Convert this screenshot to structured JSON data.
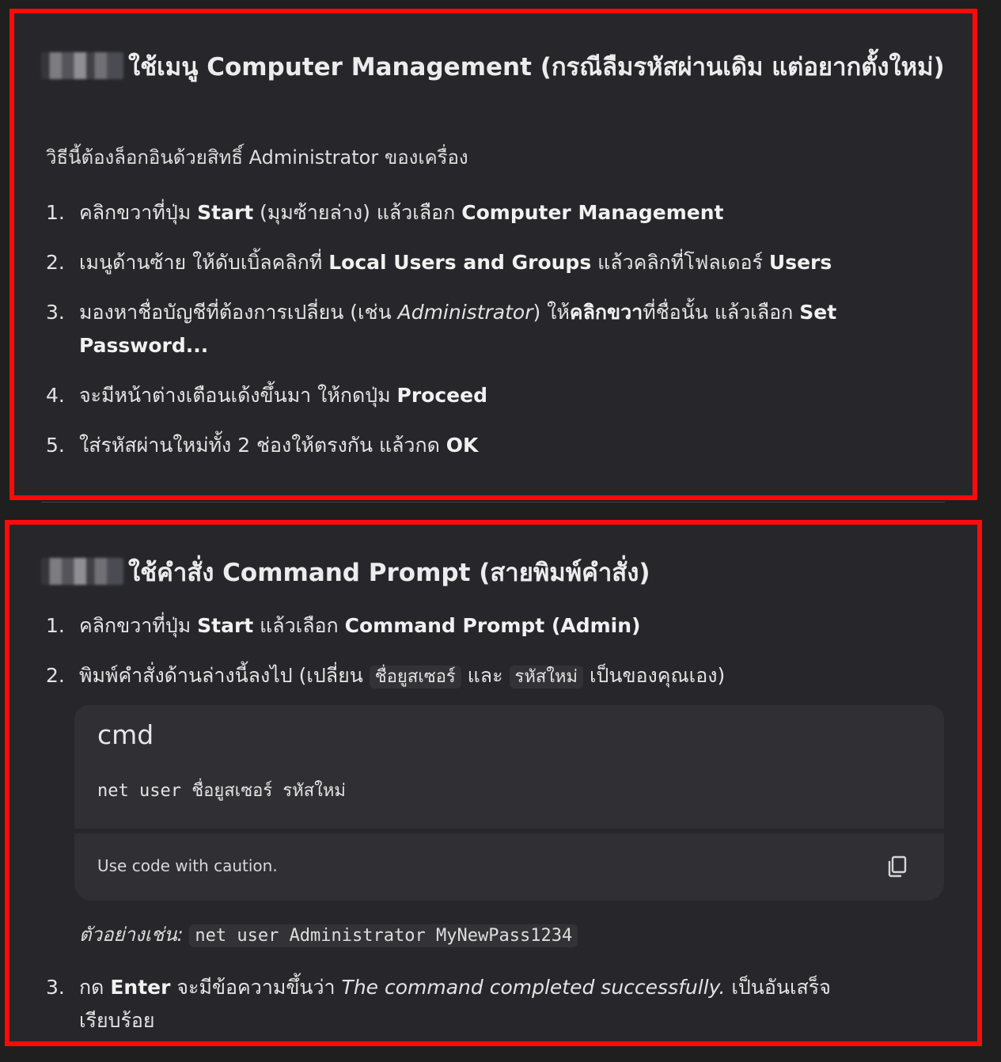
{
  "section1": {
    "heading": "ใช้เมนู Computer Management (กรณีลืมรหัสผ่านเดิม แต่อยากตั้งใหม่)",
    "intro": "วิธีนี้ต้องล็อกอินด้วยสิทธิ์ Administrator ของเครื่อง",
    "steps": [
      {
        "num": "1.",
        "t1": "คลิกขวาที่ปุ่ม ",
        "b1": "Start",
        "t2": " (มุมซ้ายล่าง) แล้วเลือก ",
        "b2": "Computer Management"
      },
      {
        "num": "2.",
        "t1": "เมนูด้านซ้าย ให้ดับเบิ้ลคลิกที่ ",
        "b1": "Local Users and Groups",
        "t2": " แล้วคลิกที่โฟลเดอร์ ",
        "b2": "Users"
      },
      {
        "num": "3.",
        "t1": "มองหาชื่อบัญชีที่ต้องการเปลี่ยน (เช่น ",
        "i1": "Administrator",
        "t2": ") ให้",
        "b1": "คลิกขวา",
        "t3": "ที่ชื่อนั้น แล้วเลือก ",
        "b2": "Set Password..."
      },
      {
        "num": "4.",
        "t1": "จะมีหน้าต่างเตือนเด้งขึ้นมา ให้กดปุ่ม ",
        "b1": "Proceed"
      },
      {
        "num": "5.",
        "t1": "ใส่รหัสผ่านใหม่ทั้ง 2 ช่องให้ตรงกัน แล้วกด ",
        "b1": "OK"
      }
    ]
  },
  "section2": {
    "heading": "ใช้คำสั่ง Command Prompt (สายพิมพ์คำสั่ง)",
    "step1": {
      "num": "1.",
      "t1": "คลิกขวาที่ปุ่ม ",
      "b1": "Start",
      "t2": " แล้วเลือก ",
      "b2": "Command Prompt (Admin)"
    },
    "step2": {
      "num": "2.",
      "t1": "พิมพ์คำสั่งด้านล่างนี้ลงไป (เปลี่ยน ",
      "c1": "ชื่อยูสเซอร์",
      "t2": " และ ",
      "c2": "รหัสใหม่",
      "t3": " เป็นของคุณเอง)"
    },
    "code": {
      "lang": "cmd",
      "text": "net user ชื่อยูสเซอร์ รหัสใหม่",
      "caution": "Use code with caution."
    },
    "example": {
      "label": "ตัวอย่างเช่น:",
      "code": "net user Administrator MyNewPass1234"
    },
    "step3": {
      "num": "3.",
      "t1": "กด ",
      "b1": "Enter",
      "t2": " จะมีข้อความขึ้นว่า ",
      "i1": "The command completed successfully.",
      "t3": " เป็นอันเสร็จเรียบร้อย"
    }
  }
}
